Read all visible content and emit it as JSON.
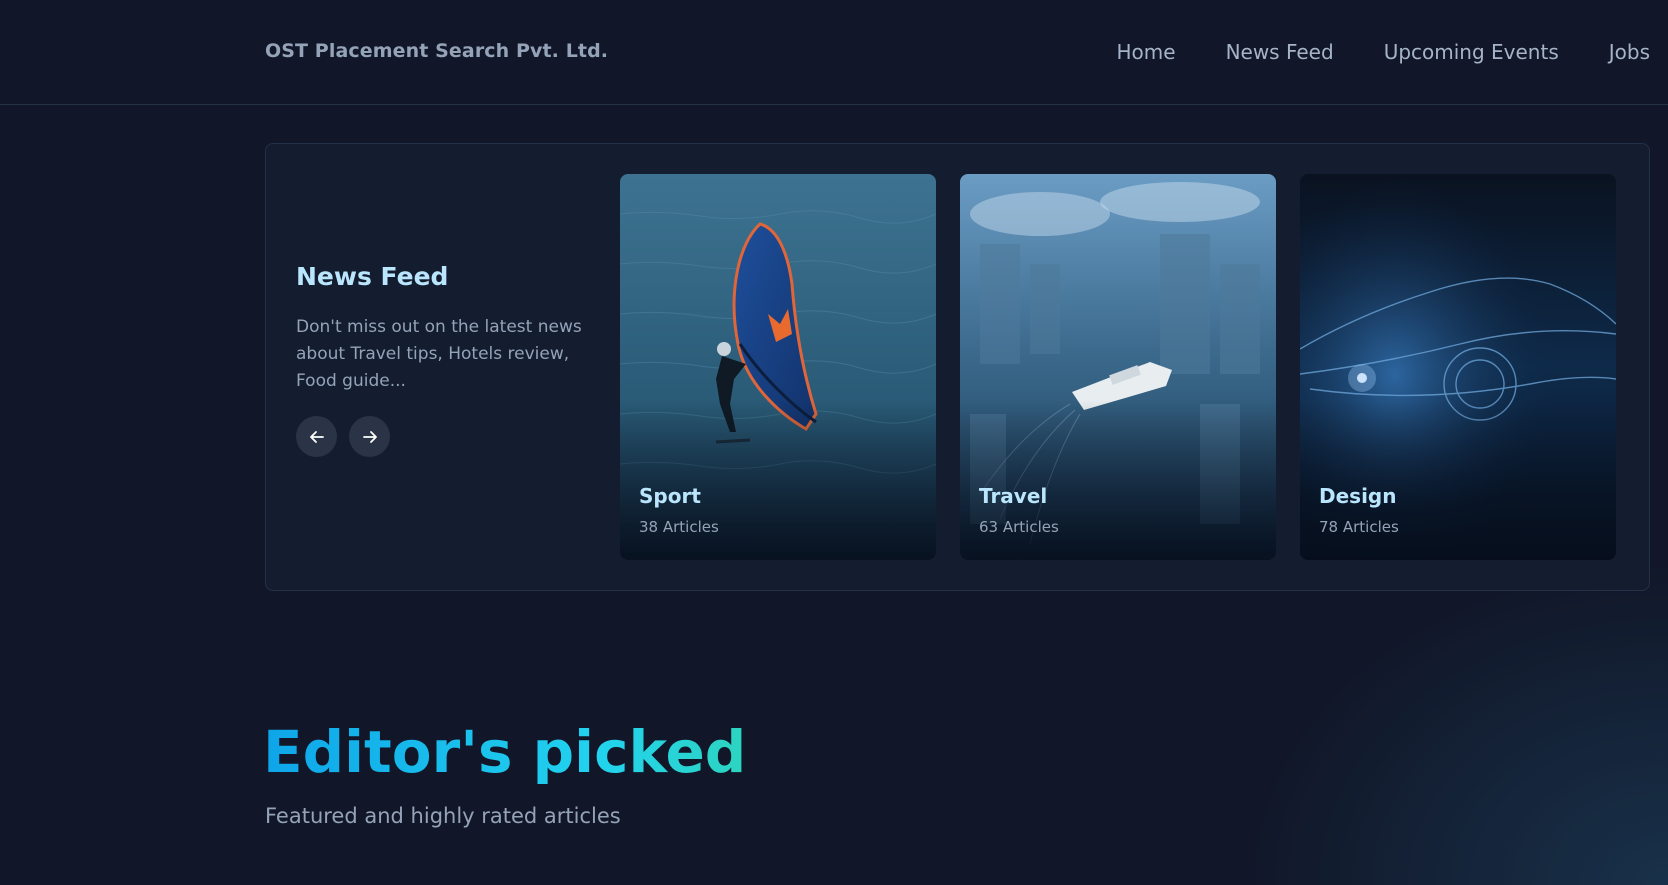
{
  "header": {
    "brand": "OST Placement Search Pvt. Ltd.",
    "nav": [
      "Home",
      "News Feed",
      "Upcoming Events",
      "Jobs"
    ]
  },
  "news_feed": {
    "title": "News Feed",
    "description": "Don't miss out on the latest news about Travel tips, Hotels review, Food guide...",
    "prev_icon": "arrow-left-icon",
    "next_icon": "arrow-right-icon",
    "cards": [
      {
        "title": "Sport",
        "count": "38 Articles"
      },
      {
        "title": "Travel",
        "count": "63 Articles"
      },
      {
        "title": "Design",
        "count": "78 Articles"
      }
    ]
  },
  "editors_picked": {
    "title": "Editor's picked",
    "subtitle": "Featured and highly rated articles"
  },
  "colors": {
    "background": "#111729",
    "accent_title": "#bae6fd",
    "gradient_start": "#0ea5e9",
    "gradient_end": "#2dd4bf"
  }
}
